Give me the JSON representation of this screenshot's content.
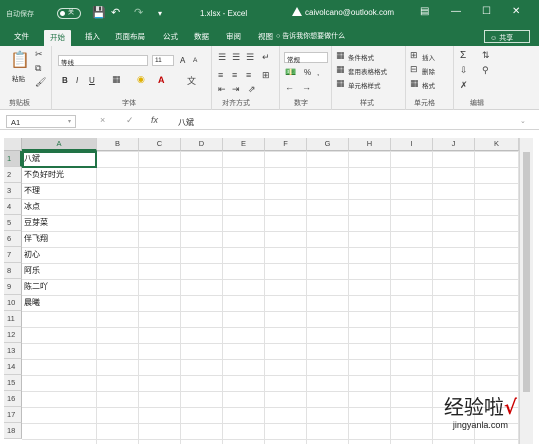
{
  "titlebar": {
    "autosave_label": "自动保存",
    "autosave_state": "关",
    "filename": "1.xlsx - Excel",
    "account": "caivolcano@outlook.com",
    "bg_color": "#217346"
  },
  "tabs": [
    "文件",
    "开始",
    "插入",
    "页面布局",
    "公式",
    "数据",
    "审阅",
    "视图"
  ],
  "active_tab": "开始",
  "tell_me": "告诉我你想要做什么",
  "share_label": "共享",
  "ribbon": {
    "clipboard": {
      "paste": "粘贴",
      "label": "剪贴板"
    },
    "font": {
      "name": "等线",
      "size": "11",
      "label": "字体",
      "bold": "B",
      "italic": "I",
      "underline": "U",
      "grow": "A",
      "shrink": "A",
      "font_color": "A"
    },
    "alignment": {
      "label": "对齐方式"
    },
    "number": {
      "format": "常规",
      "label": "数字",
      "percent": "%",
      "comma": ","
    },
    "styles": {
      "conditional": "条件格式",
      "table": "套用表格格式",
      "cell_styles": "单元格样式",
      "label": "样式"
    },
    "cells": {
      "insert": "插入",
      "delete": "删除",
      "format": "格式",
      "label": "单元格"
    },
    "editing": {
      "label": "编辑",
      "sum": "Σ"
    }
  },
  "formula_bar": {
    "name_box": "A1",
    "cancel": "×",
    "enter": "✓",
    "fx": "fx",
    "value": "八斌"
  },
  "columns": [
    "A",
    "B",
    "C",
    "D",
    "E",
    "F",
    "G",
    "H",
    "I",
    "J",
    "K"
  ],
  "rows": [
    "1",
    "2",
    "3",
    "4",
    "5",
    "6",
    "7",
    "8",
    "9",
    "10",
    "11",
    "12",
    "13",
    "14",
    "15",
    "16",
    "17",
    "18"
  ],
  "column_a": [
    "八斌",
    "不负好时光",
    "不理",
    "冰点",
    "豆芽菜",
    "伴飞翔",
    "初心",
    "阿乐",
    "陈二吖",
    "晨曦"
  ],
  "watermark": {
    "text": "经验啦",
    "check": "√",
    "sub": "jingyanla.com"
  }
}
